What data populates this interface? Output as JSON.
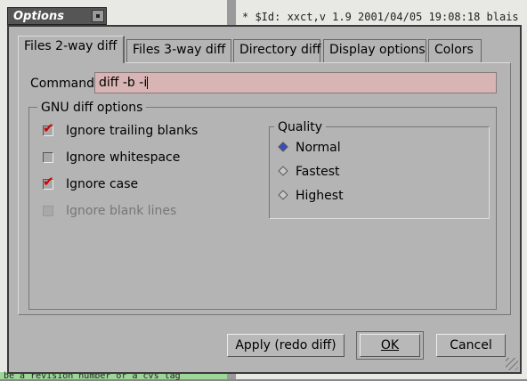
{
  "window": {
    "title": "Options"
  },
  "background": {
    "right_top_line": "* $Id: xxct,v 1.9 2001/04/05 19:08:18 blais",
    "left_bottom_line": "be a revision number or a cvs tag"
  },
  "tabs": [
    {
      "label": "Files 2-way diff",
      "active": true
    },
    {
      "label": "Files 3-way diff",
      "active": false
    },
    {
      "label": "Directory diff",
      "active": false
    },
    {
      "label": "Display options",
      "active": false
    },
    {
      "label": "Colors",
      "active": false
    }
  ],
  "command": {
    "label": "Command:",
    "value": "diff -b -i"
  },
  "gnu_options": {
    "title": "GNU diff options",
    "items": [
      {
        "label": "Ignore trailing blanks",
        "checked": true,
        "enabled": true
      },
      {
        "label": "Ignore whitespace",
        "checked": false,
        "enabled": true
      },
      {
        "label": "Ignore case",
        "checked": true,
        "enabled": true
      },
      {
        "label": "Ignore blank lines",
        "checked": false,
        "enabled": false
      }
    ]
  },
  "quality": {
    "title": "Quality",
    "options": [
      {
        "label": "Normal",
        "selected": true
      },
      {
        "label": "Fastest",
        "selected": false
      },
      {
        "label": "Highest",
        "selected": false
      }
    ]
  },
  "buttons": {
    "apply": "Apply (redo diff)",
    "ok": "OK",
    "cancel": "Cancel"
  }
}
